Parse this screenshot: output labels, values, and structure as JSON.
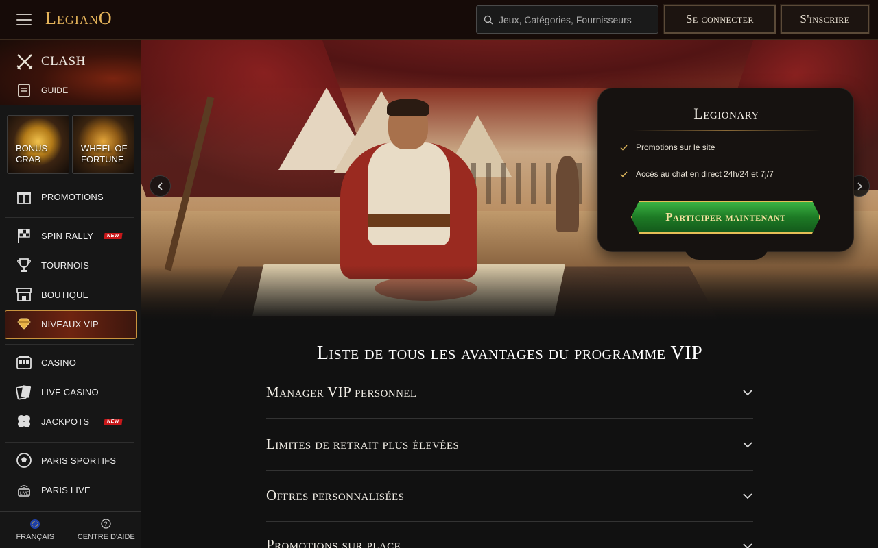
{
  "header": {
    "logo": "LegianO",
    "search_placeholder": "Jeux, Catégories, Fournisseurs",
    "login_label": "Se connecter",
    "register_label": "S'inscrire"
  },
  "sidebar": {
    "clash_label": "CLASH",
    "guide_label": "GUIDE",
    "tiles": [
      {
        "label_line1": "BONUS",
        "label_line2": "CRAB"
      },
      {
        "label_line1": "WHEEL OF",
        "label_line2": "FORTUNE"
      }
    ],
    "items": [
      {
        "label": "PROMOTIONS",
        "icon": "gift-icon"
      },
      {
        "label": "SPIN RALLY",
        "icon": "checkered-flag-icon",
        "badge": "NEW"
      },
      {
        "label": "TOURNOIS",
        "icon": "trophy-icon"
      },
      {
        "label": "BOUTIQUE",
        "icon": "shop-icon"
      },
      {
        "label": "NIVEAUX VIP",
        "icon": "diamond-icon",
        "active": true
      },
      {
        "label": "CASINO",
        "icon": "slot-machine-icon"
      },
      {
        "label": "LIVE CASINO",
        "icon": "cards-icon"
      },
      {
        "label": "JACKPOTS",
        "icon": "clover-icon",
        "badge": "NEW"
      },
      {
        "label": "PARIS SPORTIFS",
        "icon": "soccer-ball-icon"
      },
      {
        "label": "PARIS LIVE",
        "icon": "live-broadcast-icon"
      }
    ],
    "footer": {
      "language_label": "FRANÇAIS",
      "help_label": "CENTRE D'AIDE"
    }
  },
  "hero": {
    "level_title": "Legionary",
    "perks": [
      "Promotions sur le site",
      "Accès au chat en direct 24h/24 et 7j/7"
    ],
    "cta_label": "Participer maintenant"
  },
  "benefits": {
    "title": "Liste de tous les avantages du programme VIP",
    "items": [
      "Manager VIP personnel",
      "Limites de retrait plus élevées",
      "Offres personnalisées",
      "Promotions sur place"
    ]
  },
  "colors": {
    "accent_gold": "#e4b35a",
    "cta_green": "#1d7a25",
    "new_badge_red": "#c8181a",
    "background": "#111111"
  }
}
